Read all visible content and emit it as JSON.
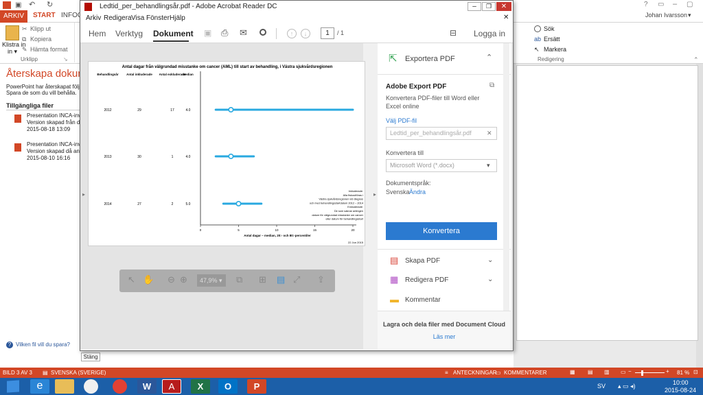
{
  "powerpoint": {
    "tabs": {
      "arkiv": "ARKIV",
      "start": "START",
      "infoga": "INFOGA"
    },
    "user": "Johan Ivarsson",
    "clipboard": {
      "klistra_in": "Klistra in",
      "klipp_ut": "Klipp ut",
      "kopiera": "Kopiera",
      "hamta_format": "Hämta format",
      "group": "Urklipp"
    },
    "editing": {
      "sok": "Sök",
      "ersatt": "Ersätt",
      "markera": "Markera",
      "group": "Redigering"
    },
    "recovery": {
      "title": "Återskapa dokume",
      "desc1": "PowerPoint har återskapat följan",
      "desc2": "Spara de som du vill behålla.",
      "available": "Tillgängliga filer",
      "files": [
        {
          "name": "Presentation INCA-inve",
          "line2": "Version skapad från de",
          "date": "2015-08-18 13:09"
        },
        {
          "name": "Presentation INCA-inve",
          "line2": "Version skapad då anv",
          "date": "2015-08-10 16:16"
        }
      ],
      "which_file": "Vilken fil vill du spara?",
      "close": "Stäng"
    },
    "status": {
      "slide": "BILD 3 AV 3",
      "lang": "SVENSKA (SVERIGE)",
      "notes": "ANTECKNINGAR",
      "comments": "KOMMENTARER",
      "zoom": "81 %"
    },
    "taskbar": {
      "lang": "SV",
      "time": "10:00",
      "date": "2015-08-24"
    }
  },
  "acrobat": {
    "title": "Ledtid_per_behandlingsår.pdf - Adobe Acrobat Reader DC",
    "menu": [
      "Arkiv",
      "Redigera",
      "Visa",
      "Fönster",
      "Hjälp"
    ],
    "tabs": {
      "hem": "Hem",
      "verktyg": "Verktyg",
      "dokument": "Dokument"
    },
    "page_current": "1",
    "page_total": "/ 1",
    "login": "Logga in",
    "zoom": "47,9%",
    "panel": {
      "export_pdf": "Exportera PDF",
      "adobe_export": "Adobe Export PDF",
      "desc": "Konvertera PDF-filer till Word eller Excel online",
      "choose_file": "Välj PDF-fil",
      "file_placeholder": "Ledtid_per_behandlingsår.pdf",
      "convert_to": "Konvertera till",
      "format": "Microsoft Word (*.docx)",
      "doc_lang_label": "Dokumentspråk:",
      "doc_lang": "Svenska",
      "change": "Ändra",
      "convert_button": "Konvertera",
      "create_pdf": "Skapa PDF",
      "edit_pdf": "Redigera PDF",
      "comment": "Kommentar",
      "cloud": "Lagra och dela filer med Document Cloud",
      "read_more": "Läs mer"
    }
  },
  "chart_data": {
    "type": "scatter",
    "title": "Antal dagar från välgrundad misstanke om cancer (AML) till start av behandling, i Västra sjukvårdsregionen",
    "columns": [
      "Behandlingsår",
      "Antal inkluderade",
      "Antal exkluderade",
      "Median"
    ],
    "rows": [
      {
        "year": "2012",
        "included": "29",
        "excluded": "17",
        "median": "4.0",
        "p20": 2,
        "p80": 20
      },
      {
        "year": "2013",
        "included": "30",
        "excluded": "1",
        "median": "4.0",
        "p20": 2,
        "p80": 7
      },
      {
        "year": "2014",
        "included": "27",
        "excluded": "2",
        "median": "5.0",
        "p20": 3,
        "p80": 8
      }
    ],
    "xlabel": "Antal dagar – median, 20:- och 80:-percentiler",
    "xticks": [
      "0",
      "5",
      "10",
      "15",
      "20"
    ],
    "xlim": [
      0,
      20
    ],
    "notes": [
      "Inkluderade:",
      "Alla fiskoutföras i",
      "Västra sjukvårdsregionen vid diagnos",
      "och med behandlingsstartdatum 2012 – 2014",
      "Exkluderade:",
      "De som saknar antingen",
      "datum för välgrundad misstanke om cancer",
      "eller datum för behandlingsstart"
    ],
    "date": "22 Jun 2015",
    "color": "#29a9e0"
  }
}
